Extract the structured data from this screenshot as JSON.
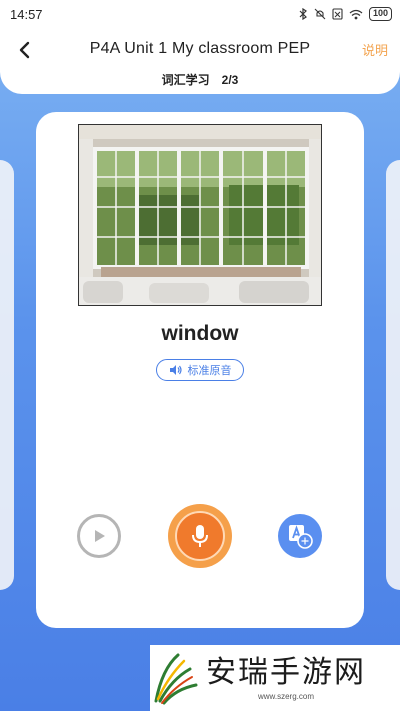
{
  "status_bar": {
    "time": "14:57",
    "battery": "100",
    "icons": [
      "bluetooth-icon",
      "mute-icon",
      "sim-off-icon",
      "wifi-icon",
      "battery-icon"
    ]
  },
  "header": {
    "title": "P4A Unit 1 My classroom PEP",
    "explain_label": "说明",
    "section_label": "词汇学习",
    "progress_label": "2/3"
  },
  "card": {
    "image_icon": "window-photo",
    "word": "window",
    "audio_label": "标准原音"
  },
  "controls": {
    "play_icon": "play-icon",
    "mic_icon": "microphone-icon",
    "translate_icon": "translate-icon"
  },
  "watermark": {
    "title": "安瑞手游网",
    "url": "www.szerg.com"
  },
  "colors": {
    "accent_blue": "#4a7fe6",
    "accent_orange": "#f07a2c",
    "explain_orange": "#f3a450"
  }
}
